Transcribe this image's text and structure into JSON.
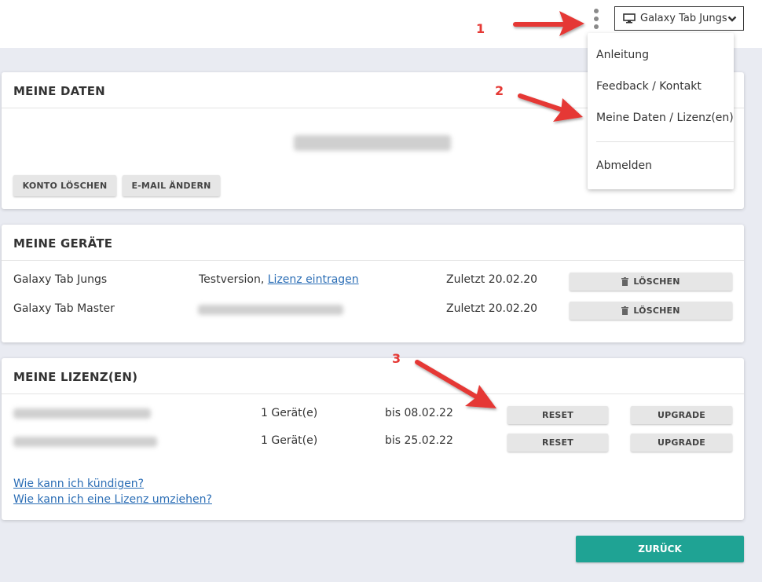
{
  "header": {
    "device_select": {
      "value": "Galaxy Tab Jungs",
      "icon": "monitor-icon"
    }
  },
  "menu": {
    "items": [
      "Anleitung",
      "Feedback / Kontakt",
      "Meine Daten / Lizenz(en)",
      "Abmelden"
    ]
  },
  "my_data": {
    "title": "MEINE DATEN",
    "delete_account_label": "KONTO LÖSCHEN",
    "change_email_label": "E-MAIL ÄNDERN"
  },
  "my_devices": {
    "title": "MEINE GERÄTE",
    "rows": [
      {
        "name": "Galaxy Tab Jungs",
        "status": "Testversion, ",
        "status_link": "Lizenz eintragen",
        "last_seen": "Zuletzt 20.02.20",
        "delete_label": "LÖSCHEN"
      },
      {
        "name": "Galaxy Tab Master",
        "last_seen": "Zuletzt 20.02.20",
        "delete_label": "LÖSCHEN"
      }
    ]
  },
  "my_licenses": {
    "title": "MEINE LIZENZ(EN)",
    "rows": [
      {
        "devices": "1 Gerät(e)",
        "valid_until": "bis 08.02.22",
        "reset_label": "RESET",
        "upgrade_label": "UPGRADE"
      },
      {
        "devices": "1 Gerät(e)",
        "valid_until": "bis 25.02.22",
        "reset_label": "RESET",
        "upgrade_label": "UPGRADE"
      }
    ],
    "links": [
      "Wie kann ich kündigen?",
      "Wie kann ich eine Lizenz umziehen?"
    ]
  },
  "footer": {
    "back_label": "ZURÜCK"
  },
  "annotations": {
    "markers": [
      "1",
      "2",
      "3"
    ],
    "arrow_color": "#e53935"
  },
  "colors": {
    "accent": "#1fa394",
    "link": "#2a6db5",
    "background": "#e9ebf2"
  }
}
